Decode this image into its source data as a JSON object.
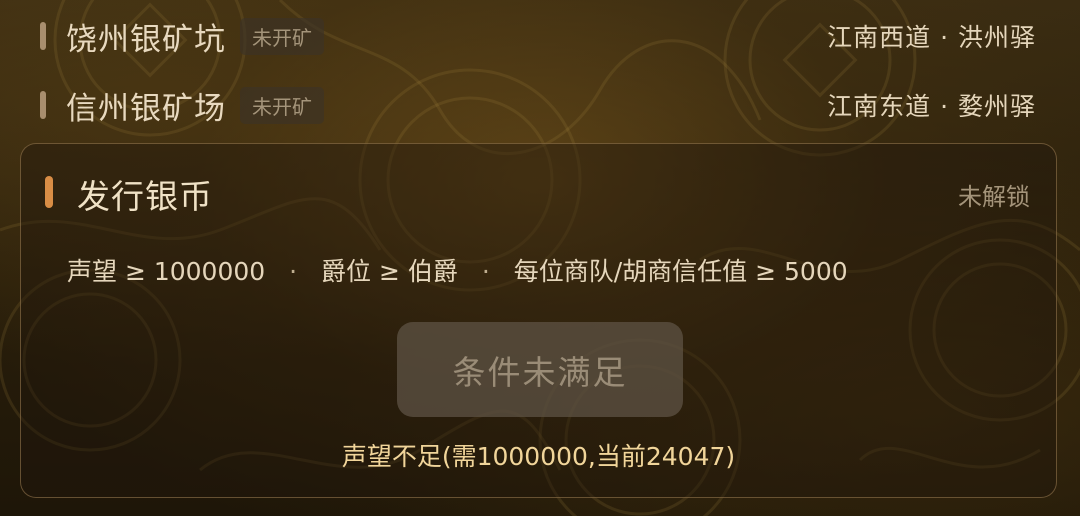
{
  "mines": [
    {
      "name": "饶州银矿坑",
      "status": "未开矿",
      "location": "江南西道 · 洪州驿"
    },
    {
      "name": "信州银矿场",
      "status": "未开矿",
      "location": "江南东道 · 婺州驿"
    }
  ],
  "mint": {
    "title": "发行银币",
    "lock_status": "未解锁",
    "requirements": [
      "声望 ≥ 1000000",
      "爵位 ≥ 伯爵",
      "每位商队/胡商信任值 ≥ 5000"
    ],
    "separator": "·",
    "button_label": "条件未满足",
    "warning": "声望不足(需1000000,当前24047)"
  }
}
